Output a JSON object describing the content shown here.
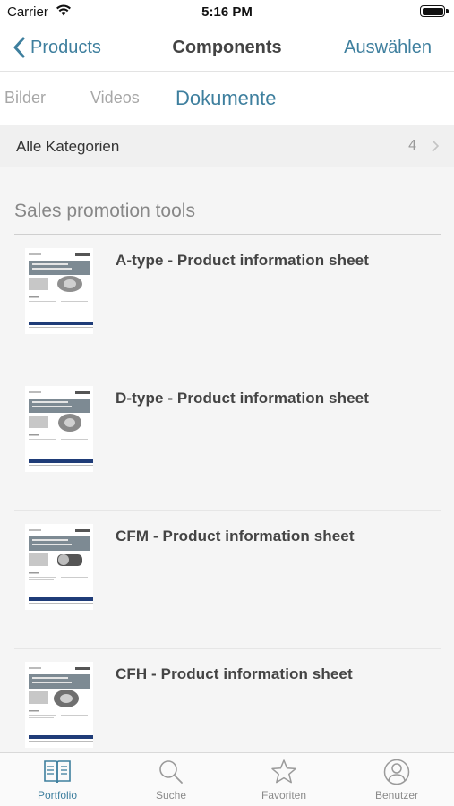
{
  "status_bar": {
    "carrier": "Carrier",
    "time": "5:16 PM"
  },
  "nav": {
    "back_label": "Products",
    "title": "Components",
    "action_label": "Auswählen"
  },
  "tabs": [
    {
      "label": "Bilder",
      "active": false
    },
    {
      "label": "Videos",
      "active": false
    },
    {
      "label": "Dokumente",
      "active": true
    }
  ],
  "category_filter": {
    "label": "Alle Kategorien",
    "count": "4"
  },
  "section": {
    "title": "Sales promotion tools",
    "documents": [
      {
        "title": "A-type - Product information sheet"
      },
      {
        "title": "D-type - Product information sheet"
      },
      {
        "title": "CFM - Product information sheet"
      },
      {
        "title": "CFH - Product information sheet"
      }
    ]
  },
  "tab_bar": [
    {
      "label": "Portfolio",
      "icon": "book-icon",
      "active": true
    },
    {
      "label": "Suche",
      "icon": "search-icon",
      "active": false
    },
    {
      "label": "Favoriten",
      "icon": "star-icon",
      "active": false
    },
    {
      "label": "Benutzer",
      "icon": "user-icon",
      "active": false
    }
  ],
  "colors": {
    "accent": "#3e7f9e",
    "inactive": "#a7a7a7",
    "doc_band": "#1f3c78"
  }
}
